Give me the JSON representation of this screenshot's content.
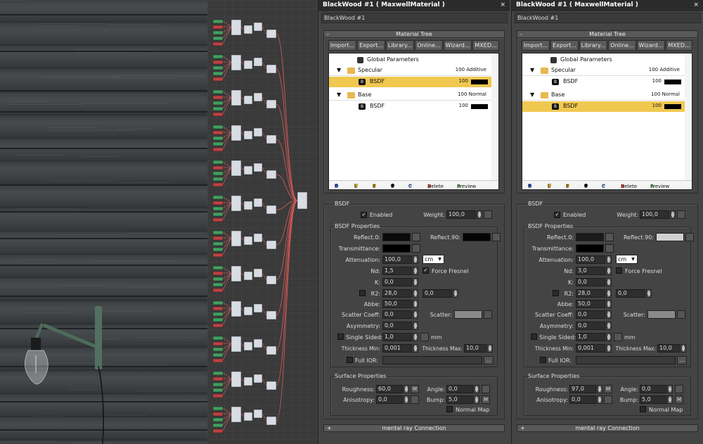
{
  "left_panel": {
    "title": "BlackWood #1  ( MaxwellMaterial )",
    "close": "×",
    "material_name": "BlackWood #1",
    "material_tree_label": "Material Tree",
    "rollout_collapse": "-",
    "toolbar": [
      "Import...",
      "Export...",
      "Library...",
      "Online...",
      "Wizard...",
      "MXED..."
    ],
    "tree": {
      "global": "Global Parameters",
      "specular": {
        "label": "Specular",
        "value": "100 Additive"
      },
      "spec_bsdf": {
        "label": "BSDF",
        "value": "100",
        "selected": true
      },
      "base": {
        "label": "Base",
        "value": "100 Normal"
      },
      "base_bsdf": {
        "label": "BSDF",
        "value": "100",
        "selected": false
      }
    },
    "tree_bar": {
      "d": "D",
      "l": "L",
      "e": "E",
      "b": "B",
      "c": "C",
      "delete": "Delete",
      "preview": "Preview"
    },
    "bsdf_group": "BSDF",
    "enabled": "Enabled",
    "weight_label": "Weight:",
    "weight": "100,0",
    "props_group": "BSDF Properties",
    "reflect0_label": "Reflect.0:",
    "reflect90_label": "Reflect.90:",
    "reflect0_color": "#0a0a0a",
    "reflect90_color": "#050505",
    "transmittance_label": "Transmittance:",
    "attenuation_label": "Attenuation:",
    "attenuation": "100,0",
    "unit": "cm",
    "nd_label": "Nd:",
    "nd": "1,5",
    "force_fresnel": "Force Fresnel",
    "force_fresnel_checked": true,
    "k_label": "K:",
    "k": "0,0",
    "r2_label": "R2:",
    "r2a": "28,0",
    "r2b": "0,0",
    "abbe_label": "Abbe:",
    "abbe": "50,0",
    "scatter_coeff_label": "Scatter Coeff:",
    "scatter_coeff": "0,0",
    "scatter_label": "Scatter:",
    "asymmetry_label": "Asymmetry:",
    "asymmetry": "0,0",
    "single_sided": "Single Sided:",
    "single_sided_val": "1,0",
    "mm": "mm",
    "thick_min_label": "Thickness Min:",
    "thick_min": "0,001",
    "thick_max_label": "Thickness Max:",
    "thick_max": "10,0",
    "full_ior": "Full IOR:",
    "ellipsis": "...",
    "surface_group": "Surface Properties",
    "roughness_label": "Roughness:",
    "roughness": "60,0",
    "angle_label": "Angle:",
    "angle": "0,0",
    "anisotropy_label": "Anisotropy:",
    "anisotropy": "0,0",
    "bump_label": "Bump:",
    "bump": "5,0",
    "m": "M",
    "normal_map": "Normal Map",
    "mental_ray": "mental ray Connection",
    "mental_ray_expand": "+"
  },
  "right_panel": {
    "title": "BlackWood #1  ( MaxwellMaterial )",
    "close": "×",
    "material_name": "BlackWood #1",
    "material_tree_label": "Material Tree",
    "rollout_collapse": "-",
    "toolbar": [
      "Import...",
      "Export...",
      "Library...",
      "Online...",
      "Wizard...",
      "MXED..."
    ],
    "tree": {
      "global": "Global Parameters",
      "specular": {
        "label": "Specular",
        "value": "100 Additive"
      },
      "spec_bsdf": {
        "label": "BSDF",
        "value": "100",
        "selected": false
      },
      "base": {
        "label": "Base",
        "value": "100 Normal"
      },
      "base_bsdf": {
        "label": "BSDF",
        "value": "100",
        "selected": true
      }
    },
    "tree_bar": {
      "d": "D",
      "l": "L",
      "e": "E",
      "b": "B",
      "c": "C",
      "delete": "Delete",
      "preview": "Preview"
    },
    "bsdf_group": "BSDF",
    "enabled": "Enabled",
    "weight_label": "Weight:",
    "weight": "100,0",
    "props_group": "BSDF Properties",
    "reflect0_label": "Reflect.0:",
    "reflect90_label": "Reflect.90:",
    "reflect0_color": "#1a1a1a",
    "reflect90_color": "#d0d0d0",
    "transmittance_label": "Transmittance:",
    "attenuation_label": "Attenuation:",
    "attenuation": "100,0",
    "unit": "cm",
    "nd_label": "Nd:",
    "nd": "3,0",
    "force_fresnel": "Force Fresnel",
    "force_fresnel_checked": false,
    "k_label": "K:",
    "k": "0,0",
    "r2_label": "R2:",
    "r2a": "28,0",
    "r2b": "0,0",
    "abbe_label": "Abbe:",
    "abbe": "50,0",
    "scatter_coeff_label": "Scatter Coeff:",
    "scatter_coeff": "0,0",
    "scatter_label": "Scatter:",
    "asymmetry_label": "Asymmetry:",
    "asymmetry": "0,0",
    "single_sided": "Single Sided:",
    "single_sided_val": "1,0",
    "mm": "mm",
    "thick_min_label": "Thickness Min:",
    "thick_min": "0,001",
    "thick_max_label": "Thickness Max:",
    "thick_max": "10,0",
    "full_ior": "Full IOR:",
    "ellipsis": "...",
    "surface_group": "Surface Properties",
    "roughness_label": "Roughness:",
    "roughness": "97,0",
    "angle_label": "Angle:",
    "angle": "0,0",
    "anisotropy_label": "Anisotropy:",
    "anisotropy": "0,0",
    "bump_label": "Bump:",
    "bump": "5,0",
    "m": "M",
    "normal_map": "Normal Map",
    "mental_ray": "mental ray Connection",
    "mental_ray_expand": "+"
  },
  "colors": {
    "selection": "#f0c850",
    "wire": "#e05a5a",
    "panel_bg": "#444444",
    "title_bg": "#2b2b2b"
  },
  "icons": {
    "expand": "triangle-down-icon",
    "folder": "folder-icon",
    "bsdf": "bsdf-badge-icon",
    "global": "global-params-icon"
  }
}
